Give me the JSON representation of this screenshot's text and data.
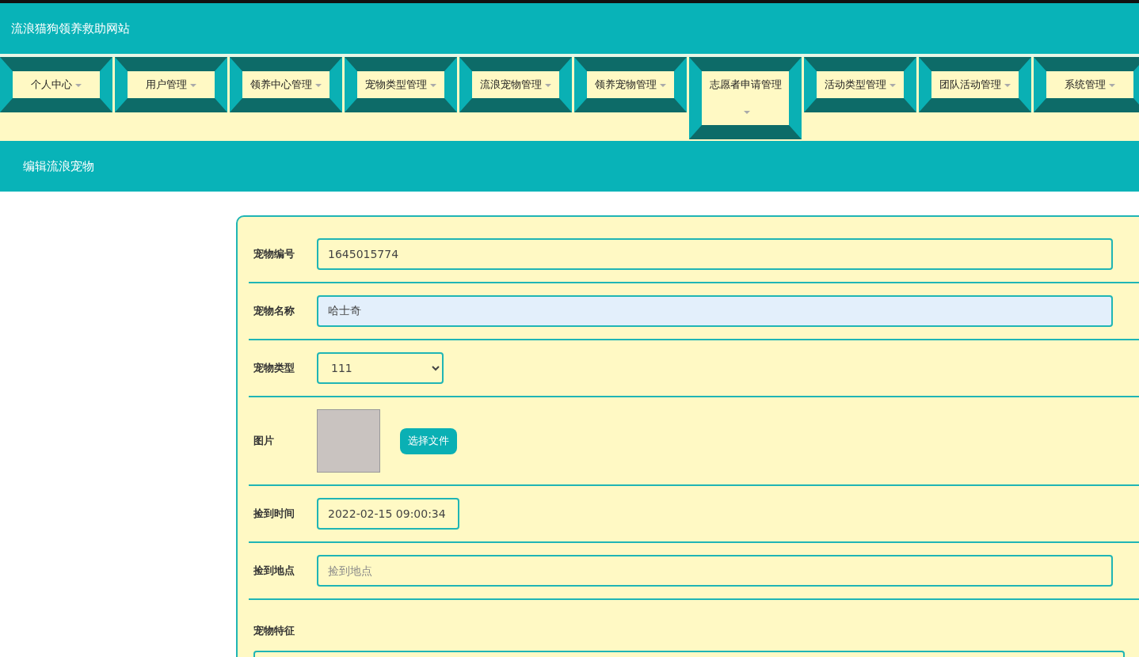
{
  "site_title": "流浪猫狗领养救助网站",
  "nav": [
    {
      "label": "个人中心"
    },
    {
      "label": "用户管理"
    },
    {
      "label": "领养中心管理"
    },
    {
      "label": "宠物类型管理"
    },
    {
      "label": "流浪宠物管理"
    },
    {
      "label": "领养宠物管理"
    },
    {
      "label": "志愿者申请管理"
    },
    {
      "label": "活动类型管理"
    },
    {
      "label": "团队活动管理"
    },
    {
      "label": "系统管理"
    }
  ],
  "page_title": "编辑流浪宠物",
  "form": {
    "fields": [
      {
        "kind": "text",
        "label": "宠物编号",
        "value": "1645015774",
        "autofilled": false
      },
      {
        "kind": "text",
        "label": "宠物名称",
        "value": "哈士奇",
        "autofilled": true
      },
      {
        "kind": "select",
        "label": "宠物类型",
        "value": "111"
      },
      {
        "kind": "image",
        "label": "图片",
        "button": "选择文件"
      },
      {
        "kind": "datetime",
        "label": "捡到时间",
        "value": "2022-02-15 09:00:34"
      },
      {
        "kind": "text",
        "label": "捡到地点",
        "placeholder": "捡到地点",
        "autofilled": false
      },
      {
        "kind": "textarea",
        "label": "宠物特征"
      }
    ]
  }
}
